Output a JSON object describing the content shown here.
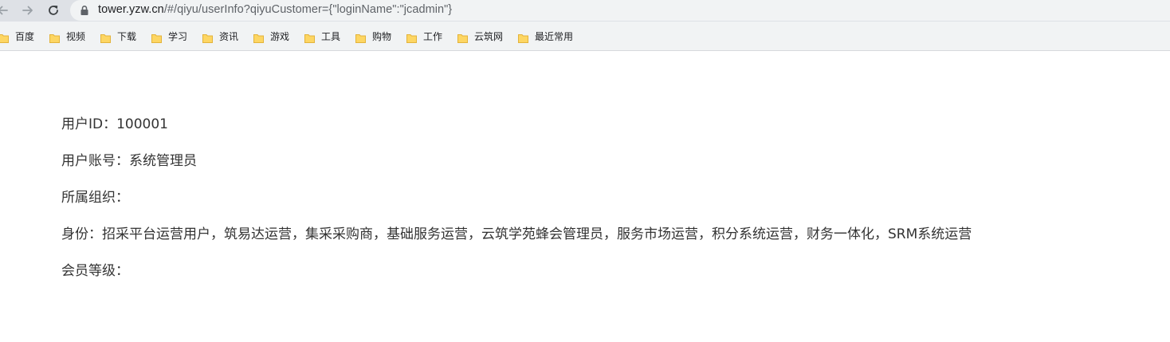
{
  "browser": {
    "url_host": "tower.yzw.cn",
    "url_path": "/#/qiyu/userInfo?qiyuCustomer={\"loginName\":\"jcadmin\"}",
    "back_icon": "arrow-left-icon",
    "forward_icon": "arrow-right-icon",
    "reload_icon": "reload-icon",
    "secure_icon": "lock-icon"
  },
  "bookmarks": [
    {
      "label": "百度"
    },
    {
      "label": "视频"
    },
    {
      "label": "下载"
    },
    {
      "label": "学习"
    },
    {
      "label": "资讯"
    },
    {
      "label": "游戏"
    },
    {
      "label": "工具"
    },
    {
      "label": "购物"
    },
    {
      "label": "工作"
    },
    {
      "label": "云筑网"
    },
    {
      "label": "最近常用"
    }
  ],
  "colors": {
    "folder_fill": "#fdd663",
    "folder_stroke": "#e3b33b",
    "text": "#333333",
    "toolbar_bg": "#dee1e6",
    "bookmarks_bg": "#f1f3f4"
  },
  "user_info": {
    "user_id": "用户ID：100001",
    "account": "用户账号：系统管理员",
    "organization": "所属组织：",
    "identity": "身份：招采平台运营用户，筑易达运营，集采采购商，基础服务运营，云筑学苑蜂会管理员，服务市场运营，积分系统运营，财务一体化，SRM系统运营",
    "member_level": "会员等级："
  }
}
